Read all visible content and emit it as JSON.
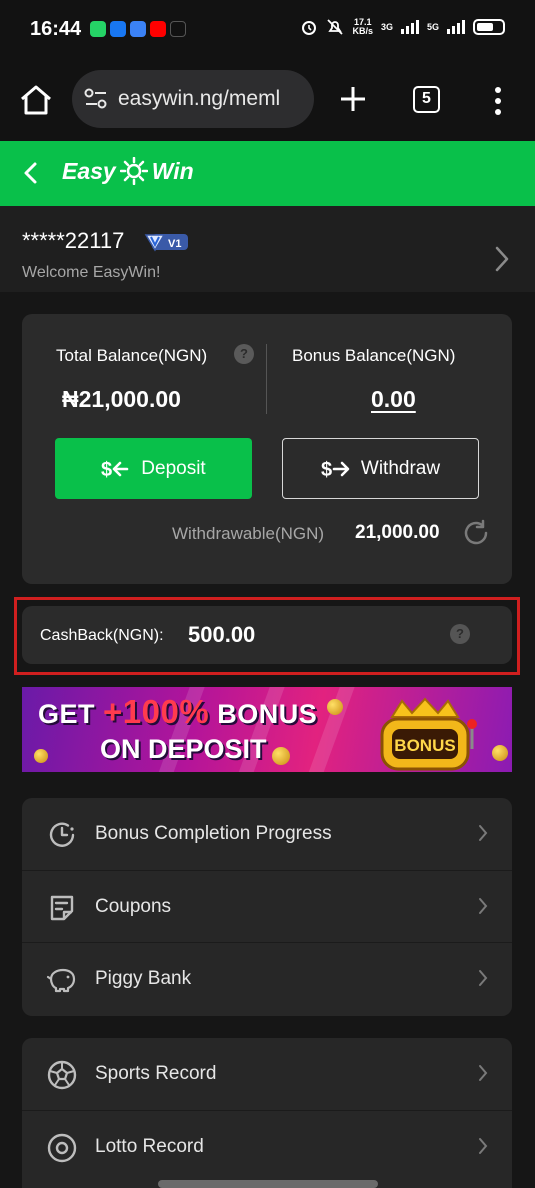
{
  "status_bar": {
    "time": "16:44",
    "net_speed_value": "17.1",
    "net_speed_unit": "KB/s",
    "network_1": "3G",
    "network_2": "5G"
  },
  "browser": {
    "url": "easywin.ng/meml",
    "tab_count": "5"
  },
  "app": {
    "logo_left": "Easy",
    "logo_right": "Win"
  },
  "profile": {
    "username": "*****22117",
    "vip_level": "V1",
    "welcome": "Welcome EasyWin!"
  },
  "balance": {
    "total_label": "Total Balance(NGN)",
    "total_value": "₦21,000.00",
    "bonus_label": "Bonus Balance(NGN)",
    "bonus_value": "0.00",
    "deposit_label": "Deposit",
    "withdraw_label": "Withdraw",
    "withdrawable_label": "Withdrawable(NGN)",
    "withdrawable_value": "21,000.00"
  },
  "cashback": {
    "label": "CashBack(NGN):",
    "value": "500.00"
  },
  "banner": {
    "word_get": "GET",
    "percent": "+100%",
    "word_bonus": "BONUS",
    "line2": "ON DEPOSIT",
    "machine_text": "BONUS"
  },
  "menu_group_1": [
    {
      "label": "Bonus Completion Progress",
      "icon": "clock-progress-icon"
    },
    {
      "label": "Coupons",
      "icon": "coupon-icon"
    },
    {
      "label": "Piggy Bank",
      "icon": "piggy-bank-icon"
    }
  ],
  "menu_group_2": [
    {
      "label": "Sports Record",
      "icon": "soccer-ball-icon"
    },
    {
      "label": "Lotto Record",
      "icon": "lotto-ball-icon"
    }
  ],
  "colors": {
    "brand_green": "#09c04a",
    "highlight_red": "#d01f1f",
    "card_bg": "#2b2b2b"
  }
}
